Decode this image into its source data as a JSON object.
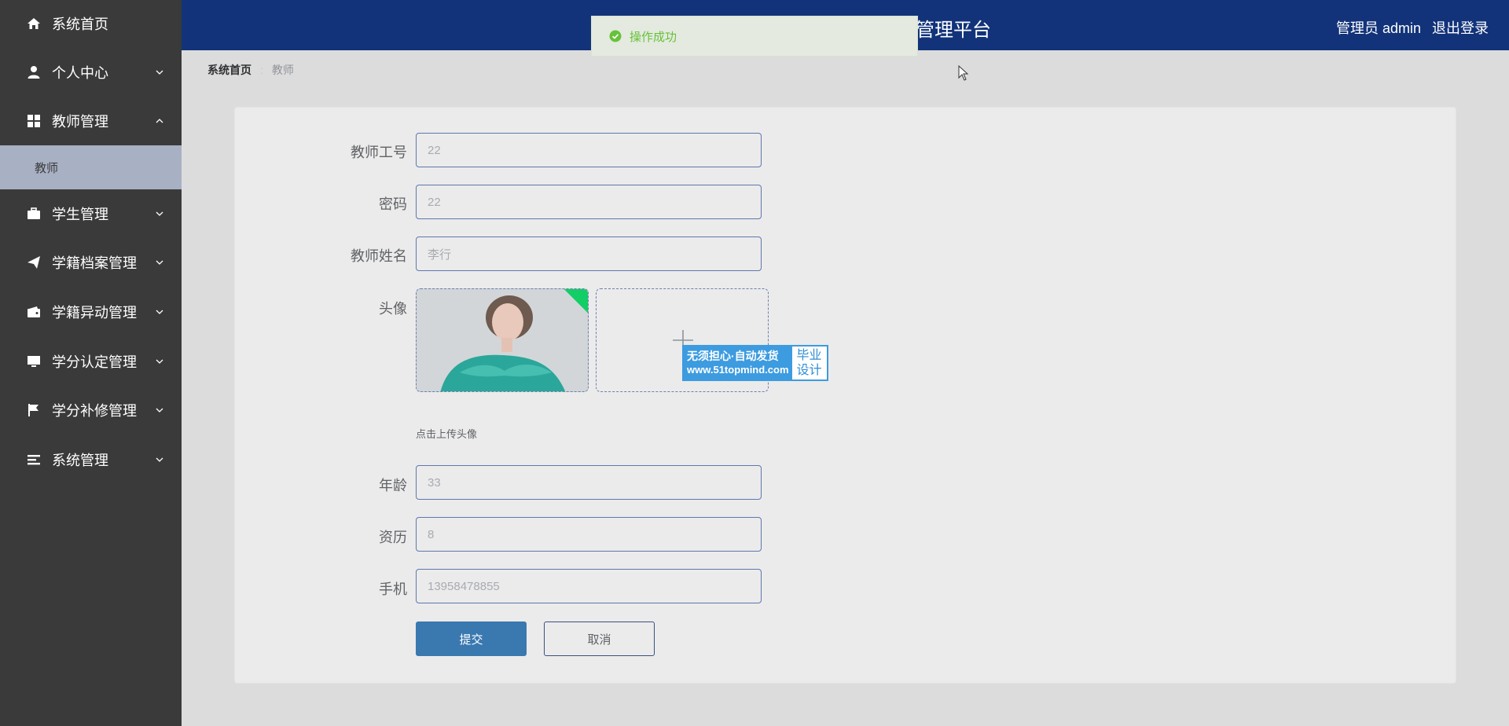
{
  "sidebar": {
    "items": [
      {
        "label": "系统首页",
        "icon": "home-icon",
        "arrow": "none"
      },
      {
        "label": "个人中心",
        "icon": "user-icon",
        "arrow": "down"
      },
      {
        "label": "教师管理",
        "icon": "grid-icon",
        "arrow": "up"
      },
      {
        "label": "学生管理",
        "icon": "briefcase-icon",
        "arrow": "down"
      },
      {
        "label": "学籍档案管理",
        "icon": "paper-plane-icon",
        "arrow": "down"
      },
      {
        "label": "学籍异动管理",
        "icon": "wallet-icon",
        "arrow": "down"
      },
      {
        "label": "学分认定管理",
        "icon": "monitor-icon",
        "arrow": "down"
      },
      {
        "label": "学分补修管理",
        "icon": "flag-icon",
        "arrow": "down"
      },
      {
        "label": "系统管理",
        "icon": "list-icon",
        "arrow": "down"
      }
    ],
    "submenu": {
      "label": "教师"
    }
  },
  "header": {
    "title": "管理平台",
    "user": "管理员 admin",
    "logout": "退出登录"
  },
  "toast": {
    "text": "操作成功",
    "color": "#67c23a"
  },
  "breadcrumb": {
    "home": "系统首页",
    "separator": ":",
    "current": "教师"
  },
  "form": {
    "teacher_id": {
      "label": "教师工号",
      "value": "22"
    },
    "password": {
      "label": "密码",
      "value": "22"
    },
    "teacher_name": {
      "label": "教师姓名",
      "value": "李行"
    },
    "avatar": {
      "label": "头像",
      "tip": "点击上传头像"
    },
    "age": {
      "label": "年龄",
      "value": "33"
    },
    "experience": {
      "label": "资历",
      "value": "8"
    },
    "phone": {
      "label": "手机",
      "value": "13958478855"
    },
    "submit_label": "提交",
    "cancel_label": "取消"
  },
  "watermark": {
    "line1": "无须担心·自动发货",
    "line2": "www.51topmind.com",
    "right_line1": "毕业",
    "right_line2": "设计"
  },
  "colors": {
    "sidebar_bg": "#3a3a3a",
    "header_bg": "#12337a",
    "submenu_active_bg": "#a8b0c3",
    "submit_bg": "#3a78b0",
    "success": "#13ce66"
  }
}
